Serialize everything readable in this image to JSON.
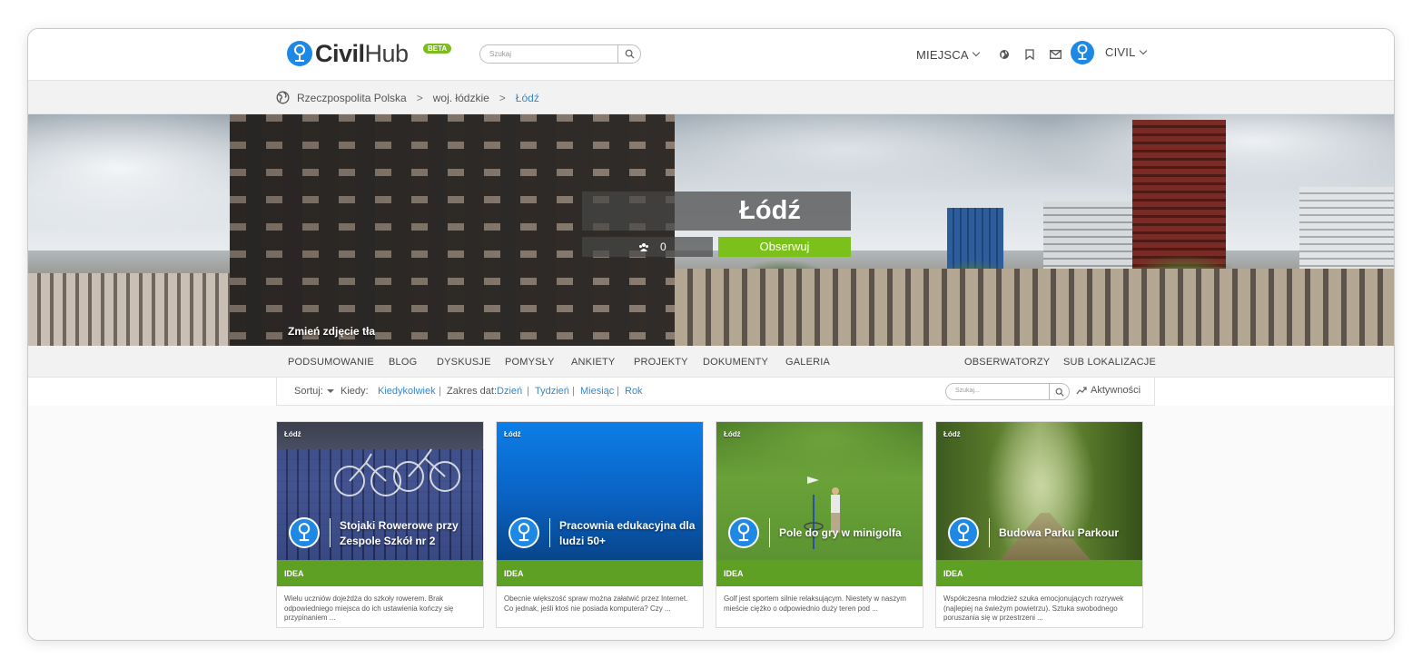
{
  "header": {
    "logo_civil": "Civil",
    "logo_hub": "Hub",
    "beta": "BETA",
    "search_placeholder": "Szukaj",
    "menu_places": "MIEJSCA",
    "user_name": "CIVIL"
  },
  "breadcrumb": {
    "items": [
      "Rzeczpospolita Polska",
      "woj. łódzkie",
      "Łódź"
    ],
    "separator": ">"
  },
  "hero": {
    "title": "Łódź",
    "followers": "0",
    "follow_label": "Obserwuj",
    "change_bg_label": "Zmień zdjęcie tła"
  },
  "tabs": {
    "left": [
      "PODSUMOWANIE",
      "BLOG",
      "DYSKUSJE",
      "POMYSŁY",
      "ANKIETY",
      "PROJEKTY",
      "DOKUMENTY",
      "GALERIA"
    ],
    "right": [
      "OBSERWATORZY",
      "SUB LOKALIZACJE"
    ]
  },
  "filters": {
    "sort_label": "Sortuj:",
    "when_label": "Kiedy:",
    "when_value": "Kiedykolwiek",
    "range_label": "Zakres dat:",
    "range_options": [
      "Dzień",
      "Tydzień",
      "Miesiąc",
      "Rok"
    ],
    "search_placeholder": "Szukaj...",
    "activity_label": "Aktywności"
  },
  "cards": [
    {
      "location": "Łódź",
      "title": "Stojaki Rowerowe przy Zespole Szkół nr 2",
      "type": "IDEA",
      "description": "Wielu uczniów dojeżdża do szkoły rowerem. Brak odpowiedniego miejsca do ich ustawienia kończy się przypinaniem ..."
    },
    {
      "location": "Łódź",
      "title": "Pracownia edukacyjna dla ludzi 50+",
      "type": "IDEA",
      "description": "Obecnie większość spraw można załatwić przez Internet. Co jednak, jeśli ktoś nie posiada komputera? Czy ..."
    },
    {
      "location": "Łódź",
      "title": "Pole do gry w minigolfa",
      "type": "IDEA",
      "description": "Golf jest sportem silnie relaksującym. Niestety w naszym mieście ciężko o odpowiednio duży teren pod ..."
    },
    {
      "location": "Łódź",
      "title": "Budowa Parku Parkour",
      "type": "IDEA",
      "description": "Współczesna młodzież szuka emocjonujących rozrywek (najlepiej na świeżym powietrzu). Sztuka swobodnego poruszania się w przestrzeni ..."
    }
  ],
  "colors": {
    "brand_blue": "#1e88e5",
    "follow_green": "#7cc11b",
    "idea_green": "#5ea023",
    "link_blue": "#3a86c8"
  }
}
